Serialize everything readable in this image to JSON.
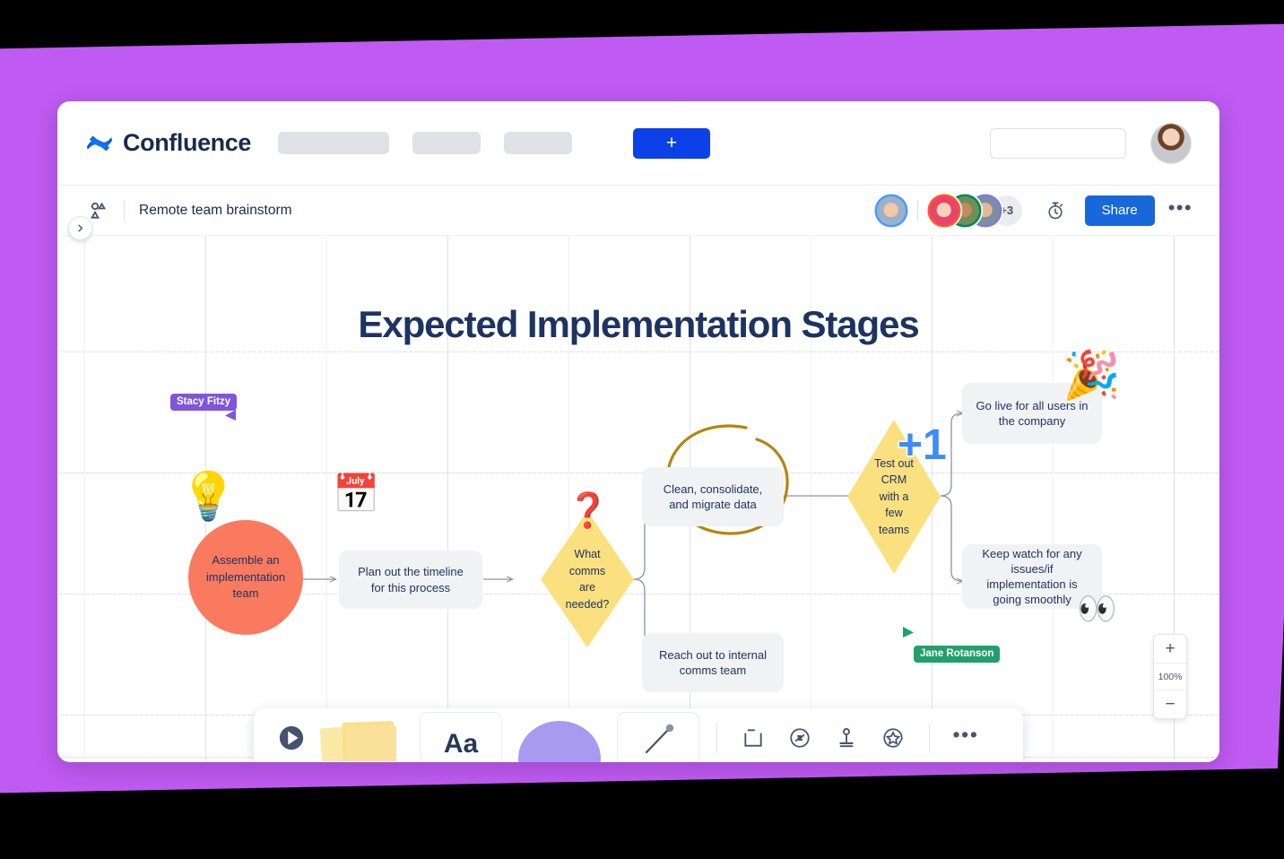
{
  "app": {
    "brand_name": "Confluence",
    "brand_logo_icon": "confluence-logo-icon",
    "create_button_label": "+",
    "nav_placeholders": [
      "",
      "",
      ""
    ],
    "search": {
      "value": "",
      "placeholder": "",
      "icon": "search-icon"
    },
    "user_avatar_icon": "user-avatar"
  },
  "board_header": {
    "whiteboard_icon": "whiteboard-icon",
    "title": "Remote team brainstorm",
    "collaborators_overflow": "+3",
    "timer_icon": "stopwatch-icon",
    "share_label": "Share",
    "more_label": "•••",
    "sidebar_toggle_icon": "chevron-right-icon"
  },
  "canvas": {
    "title": "Expected Implementation Stages",
    "nodes": [
      {
        "id": "assemble",
        "label": "Assemble an implementation team"
      },
      {
        "id": "timeline",
        "label": "Plan out the timeline for this process"
      },
      {
        "id": "comms",
        "label": "What comms are needed?"
      },
      {
        "id": "migrate",
        "label": "Clean, consolidate, and migrate data"
      },
      {
        "id": "internal",
        "label": "Reach out to internal comms team"
      },
      {
        "id": "testcrm",
        "label": "Test out CRM with a few teams"
      },
      {
        "id": "golive",
        "label": "Go live for all users in the company"
      },
      {
        "id": "keepwatch",
        "label": "Keep watch for any issues/if implementation is going smoothly"
      }
    ],
    "stickers": [
      {
        "id": "lightbulb",
        "icon": "lightbulb-emoji",
        "glyph": "💡"
      },
      {
        "id": "calendar",
        "icon": "calendar-emoji",
        "glyph": "📅"
      },
      {
        "id": "question",
        "icon": "question-mark-emoji",
        "glyph": "❓"
      },
      {
        "id": "plusone",
        "icon": "plus-one-emoji",
        "glyph": "+1"
      },
      {
        "id": "party",
        "icon": "party-popper-emoji",
        "glyph": "🎉"
      },
      {
        "id": "eyes",
        "icon": "eyes-emoji",
        "glyph": "👀"
      }
    ],
    "cursors": [
      {
        "name": "Stacy Fitzy",
        "color": "#7f56d9"
      },
      {
        "name": "Jane Rotanson",
        "color": "#22a06b"
      }
    ],
    "zoom": {
      "in_label": "+",
      "level": "100%",
      "out_label": "−"
    }
  },
  "toolbar": {
    "items": [
      {
        "id": "select",
        "label": "",
        "icon": "cursor-select-icon"
      },
      {
        "id": "sticky",
        "label": "",
        "icon": "sticky-notes-icon"
      },
      {
        "id": "text",
        "label": "Aa",
        "icon": "text-tool-icon"
      },
      {
        "id": "shape",
        "label": "",
        "icon": "shape-tool-icon"
      },
      {
        "id": "pen",
        "label": "",
        "icon": "pen-tool-icon"
      },
      {
        "id": "frame",
        "label": "",
        "icon": "frame-icon"
      },
      {
        "id": "jira",
        "label": "",
        "icon": "jira-smart-link-icon"
      },
      {
        "id": "stamp",
        "label": "",
        "icon": "stamp-icon"
      },
      {
        "id": "sticker",
        "label": "",
        "icon": "sticker-star-icon"
      },
      {
        "id": "more",
        "label": "•••",
        "icon": "more-icon"
      }
    ]
  },
  "colors": {
    "brand_blue": "#0c41e8",
    "share_blue": "#1868db",
    "accent_purple": "#bf5af2",
    "node_gray": "#f1f2f4",
    "diamond_yellow": "#fae07f",
    "circle_orange": "#f97a5f",
    "title_navy": "#1d3461",
    "annotation_gold": "#b58510"
  }
}
